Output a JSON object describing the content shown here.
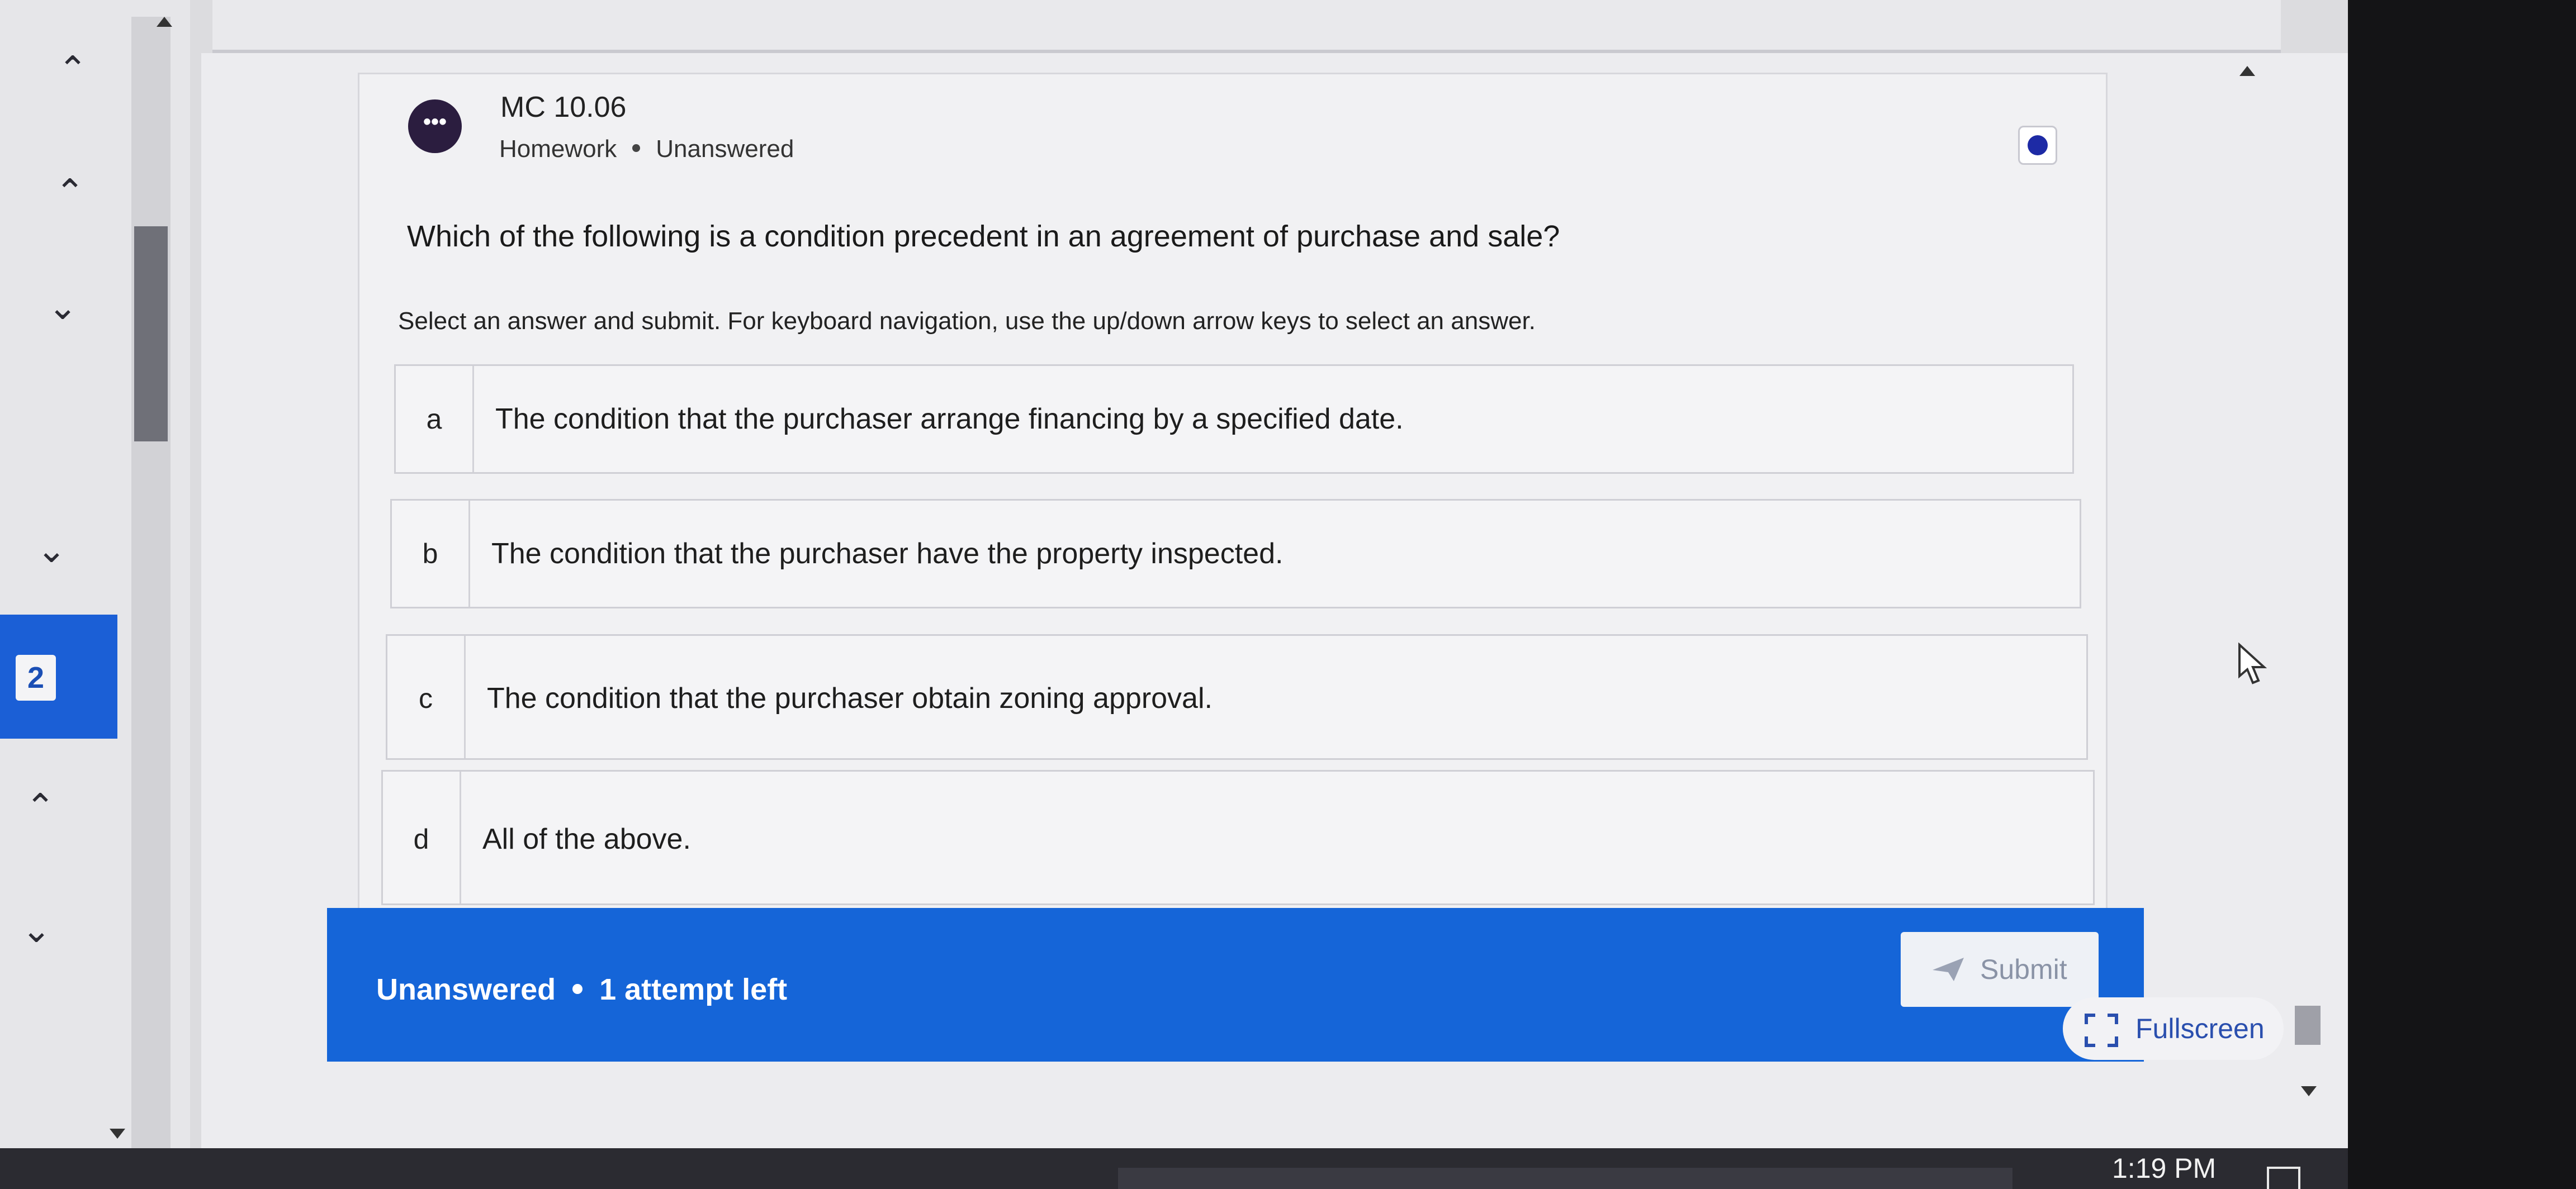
{
  "left_rail": {
    "badge_number": "2",
    "chevrons": [
      "up",
      "up",
      "down",
      "down",
      "up",
      "down"
    ]
  },
  "question": {
    "id": "MC 10.06",
    "avatar_text": "•••",
    "type": "Homework",
    "status": "Unanswered",
    "text": "Which of the following is a condition precedent in an agreement of purchase and sale?",
    "instructions": "Select an answer and submit. For keyboard navigation, use the up/down arrow keys to select an answer."
  },
  "options": [
    {
      "letter": "a",
      "text": "The condition that the purchaser arrange financing by a specified date."
    },
    {
      "letter": "b",
      "text": "The condition that the purchaser have the property inspected."
    },
    {
      "letter": "c",
      "text": "The condition that the purchaser obtain zoning approval."
    },
    {
      "letter": "d",
      "text": "All of the above."
    }
  ],
  "footer": {
    "status": "Unanswered",
    "attempts": "1 attempt left",
    "submit_label": "Submit",
    "fullscreen_label": "Fullscreen"
  },
  "taskbar": {
    "time": "1:19 PM"
  },
  "colors": {
    "accent_blue": "#1565d8",
    "rail_active": "#1b5fd6",
    "avatar_bg": "#2b1d3f",
    "bookmark_dot": "#1d2aa5"
  }
}
